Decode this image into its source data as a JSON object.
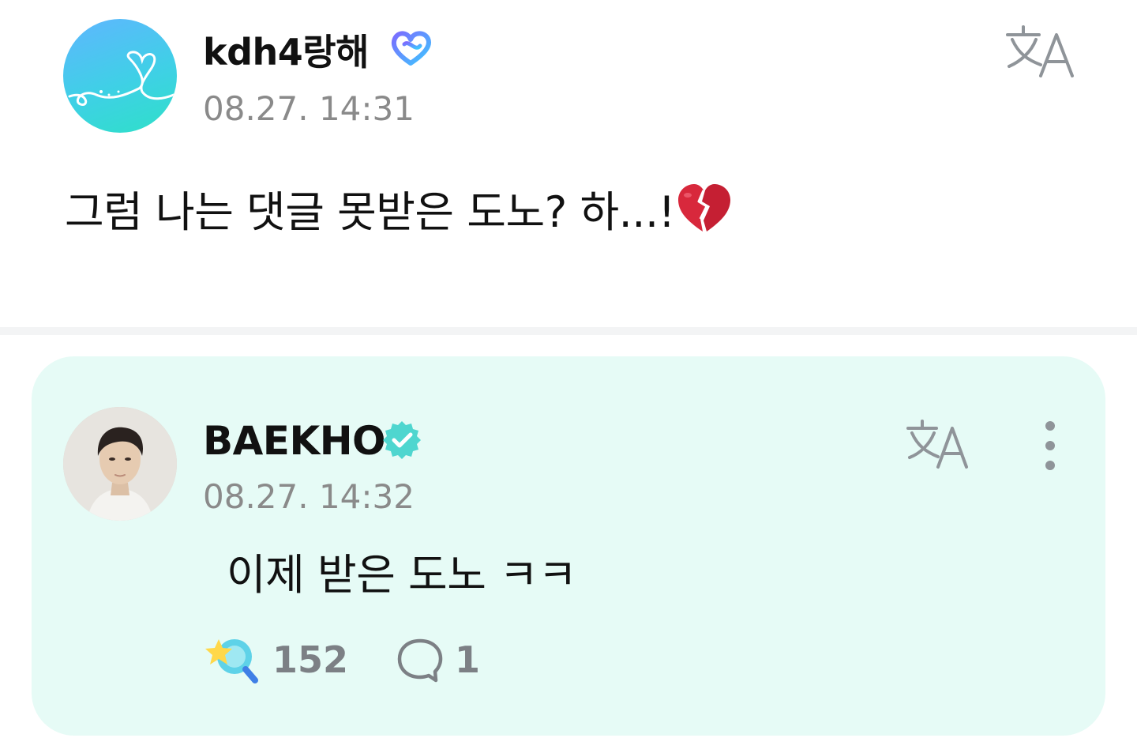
{
  "post": {
    "author": "kdh4랑해",
    "author_badge": "fan-heart-badge-icon",
    "timestamp": "08.27. 14:31",
    "text": "그럼 나는 댓글 못받은 도노? 하...!",
    "emoji": "broken-heart-icon",
    "translate_icon": "translate-icon"
  },
  "reply": {
    "author": "BAEKHO",
    "author_badge": "verified-badge-icon",
    "timestamp": "08.27. 14:32",
    "text": "이제 받은 도노 ㅋㅋ",
    "likes": "152",
    "comments": "1",
    "translate_icon": "translate-icon",
    "more_icon": "more-vertical-icon"
  },
  "colors": {
    "reply_bg": "#e6fbf6",
    "divider": "#f3f4f5",
    "timestamp": "#8a8a8a",
    "icon_gray": "#7c8085",
    "verified": "#4fd6cf",
    "fan_badge_start": "#7b6cff",
    "fan_badge_end": "#3ec6ff"
  }
}
